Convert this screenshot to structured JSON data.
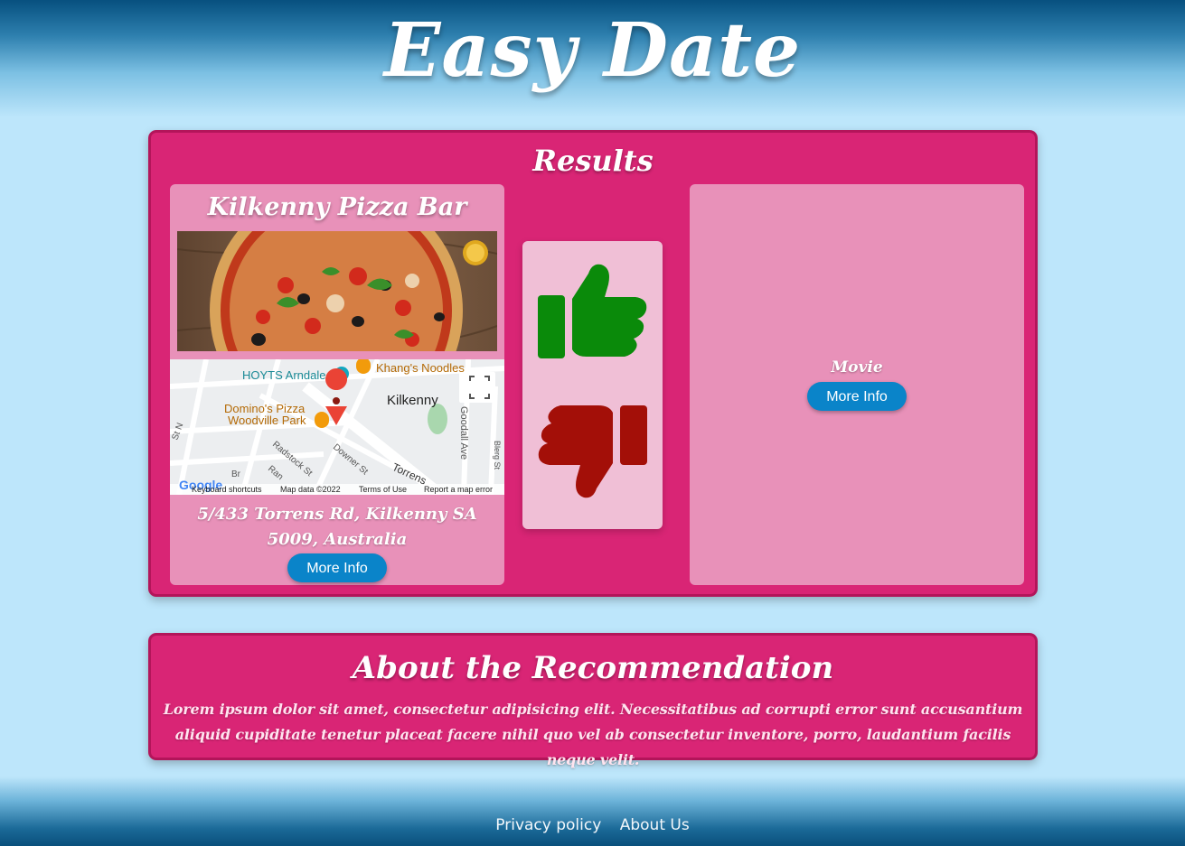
{
  "header": {
    "title": "Easy Date"
  },
  "results": {
    "title": "Results",
    "restaurant": {
      "name": "Kilkenny Pizza Bar",
      "address": "5/433 Torrens Rd, Kilkenny SA 5009, Australia",
      "more_info_label": "More Info",
      "map": {
        "places": [
          "HOYTS Arndale",
          "Khang's Noodles",
          "Domino's Pizza",
          "Woodville Park",
          "Kilkenny"
        ],
        "streets": [
          "Goodall Ave",
          "Radstock St",
          "Downer St",
          "Torrens",
          "Blerg St",
          "Ran",
          "Br",
          "St N"
        ],
        "footer": [
          "Keyboard shortcuts",
          "Map data ©2022",
          "Terms of Use",
          "Report a map error"
        ],
        "logo": "Google"
      }
    },
    "vote": {
      "like_icon": "thumbs-up-icon",
      "dislike_icon": "thumbs-down-icon",
      "like_color": "#0a8a0a",
      "dislike_color": "#a30f08"
    },
    "movie": {
      "label": "Movie",
      "more_info_label": "More Info"
    }
  },
  "about": {
    "title": "About the Recommendation",
    "text": "Lorem ipsum dolor sit amet, consectetur adipisicing elit. Necessitatibus ad corrupti error sunt accusantium aliquid cupiditate tenetur placeat facere nihil quo vel ab consectetur inventore, porro, laudantium facilis neque velit."
  },
  "footer": {
    "links": [
      "Privacy policy",
      "About Us"
    ]
  },
  "colors": {
    "panel": "#d92575",
    "card": "#e891b9",
    "button": "#0a84c9",
    "background": "#bde6fb"
  }
}
